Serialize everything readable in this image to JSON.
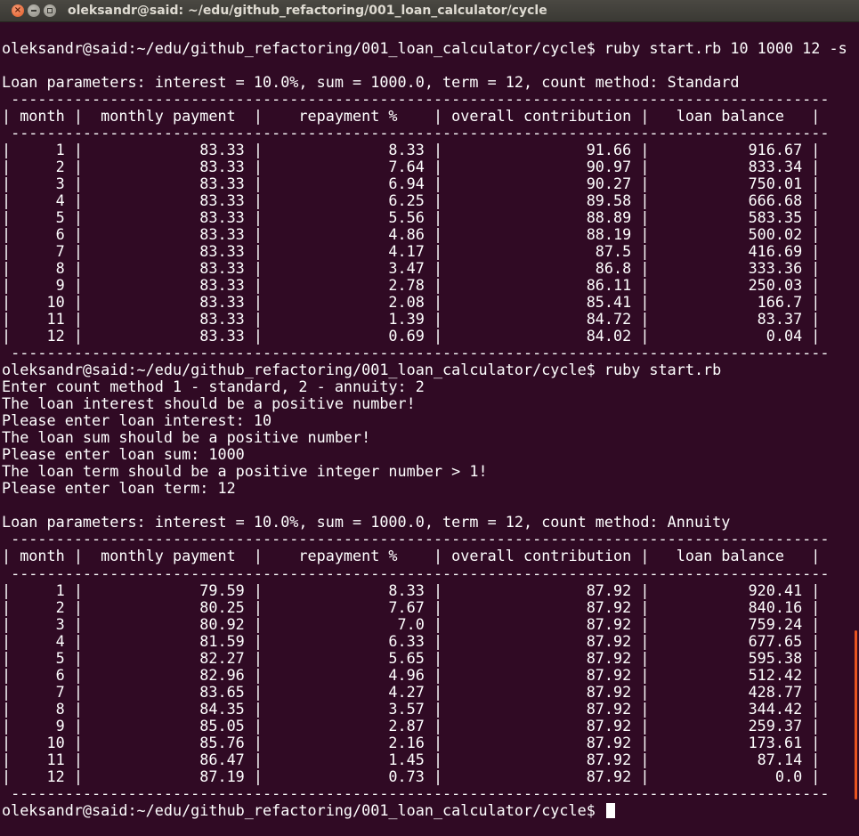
{
  "window": {
    "title": "oleksandr@said: ~/edu/github_refactoring/001_loan_calculator/cycle",
    "close_glyph": "×",
    "min_glyph": "",
    "max_glyph": ""
  },
  "terminal": {
    "lines": [
      "",
      "oleksandr@said:~/edu/github_refactoring/001_loan_calculator/cycle$ ruby start.rb 10 1000 12 -s",
      "",
      "Loan parameters: interest = 10.0%, sum = 1000.0, term = 12, count method: Standard",
      " -------------------------------------------------------------------------------------------",
      "| month |  monthly payment  |    repayment %    | overall contribution |   loan balance   |",
      " -------------------------------------------------------------------------------------------",
      "|     1 |             83.33 |              8.33 |                91.66 |           916.67 |",
      "|     2 |             83.33 |              7.64 |                90.97 |           833.34 |",
      "|     3 |             83.33 |              6.94 |                90.27 |           750.01 |",
      "|     4 |             83.33 |              6.25 |                89.58 |           666.68 |",
      "|     5 |             83.33 |              5.56 |                88.89 |           583.35 |",
      "|     6 |             83.33 |              4.86 |                88.19 |           500.02 |",
      "|     7 |             83.33 |              4.17 |                 87.5 |           416.69 |",
      "|     8 |             83.33 |              3.47 |                 86.8 |           333.36 |",
      "|     9 |             83.33 |              2.78 |                86.11 |           250.03 |",
      "|    10 |             83.33 |              2.08 |                85.41 |            166.7 |",
      "|    11 |             83.33 |              1.39 |                84.72 |            83.37 |",
      "|    12 |             83.33 |              0.69 |                84.02 |             0.04 |",
      " -------------------------------------------------------------------------------------------",
      "oleksandr@said:~/edu/github_refactoring/001_loan_calculator/cycle$ ruby start.rb",
      "Enter count method 1 - standard, 2 - annuity: 2",
      "The loan interest should be a positive number!",
      "Please enter loan interest: 10",
      "The loan sum should be a positive number!",
      "Please enter loan sum: 1000",
      "The loan term should be a positive integer number > 1!",
      "Please enter loan term: 12",
      "",
      "Loan parameters: interest = 10.0%, sum = 1000.0, term = 12, count method: Annuity",
      " -------------------------------------------------------------------------------------------",
      "| month |  monthly payment  |    repayment %    | overall contribution |   loan balance   |",
      " -------------------------------------------------------------------------------------------",
      "|     1 |             79.59 |              8.33 |                87.92 |           920.41 |",
      "|     2 |             80.25 |              7.67 |                87.92 |           840.16 |",
      "|     3 |             80.92 |               7.0 |                87.92 |           759.24 |",
      "|     4 |             81.59 |              6.33 |                87.92 |           677.65 |",
      "|     5 |             82.27 |              5.65 |                87.92 |           595.38 |",
      "|     6 |             82.96 |              4.96 |                87.92 |           512.42 |",
      "|     7 |             83.65 |              4.27 |                87.92 |           428.77 |",
      "|     8 |             84.35 |              3.57 |                87.92 |           344.42 |",
      "|     9 |             85.05 |              2.87 |                87.92 |           259.37 |",
      "|    10 |             85.76 |              2.16 |                87.92 |           173.61 |",
      "|    11 |             86.47 |              1.45 |                87.92 |            87.14 |",
      "|    12 |             87.19 |              0.73 |                87.92 |              0.0 |",
      " -------------------------------------------------------------------------------------------"
    ],
    "prompt": "oleksandr@said:~/edu/github_refactoring/001_loan_calculator/cycle$ "
  },
  "colors": {
    "background": "#300a24",
    "text": "#ffffff",
    "scroll_thumb": "#e95420"
  }
}
